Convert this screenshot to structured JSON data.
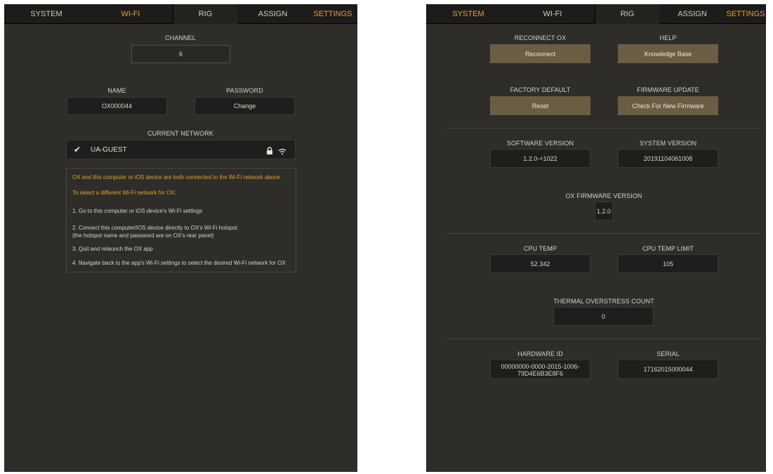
{
  "colors": {
    "accent": "#e3a32b",
    "panel_bg": "#2e2d2a",
    "tabbar_bg": "#1d1c1a",
    "field_bg": "#1f1e1c",
    "button_bg": "#6b5d43"
  },
  "wifi_screen": {
    "tabs": {
      "system": "SYSTEM",
      "wifi": "WI-FI",
      "rig": "RIG",
      "assign": "ASSIGN",
      "settings": "SETTINGS"
    },
    "active_tab": "WI-FI",
    "channel": {
      "label": "CHANNEL",
      "value": "6"
    },
    "name": {
      "label": "NAME",
      "value": "OX000044"
    },
    "password": {
      "label": "PASSWORD",
      "button": "Change"
    },
    "current_network": {
      "label": "CURRENT NETWORK",
      "ssid": "UA-GUEST",
      "icons": [
        "checkmark-icon",
        "lock-icon",
        "wifi-signal-icon"
      ]
    },
    "info": {
      "line1": "OX and this computer or iOS device are both connected to the Wi-Fi network above.",
      "line2": "To select a different Wi-Fi network for OX:",
      "step1": "1. Go to this computer or iOS device's Wi-Fi settings",
      "step2a": "2. Connect this computer/iOS device directly to OX's Wi-Fi hotspot",
      "step2b": "(the hotspot name and password are on OX's rear panel)",
      "step3": "3. Quit and relaunch the OX app",
      "step4": "4. Navigate back to the app's Wi-Fi settings to select the desired Wi-Fi network for OX"
    }
  },
  "system_screen": {
    "tabs": {
      "system": "SYSTEM",
      "wifi": "WI-FI",
      "rig": "RIG",
      "assign": "ASSIGN",
      "settings": "SETTINGS"
    },
    "active_tab": "SYSTEM",
    "reconnect": {
      "label": "RECONNECT OX",
      "button": "Reconnect"
    },
    "help": {
      "label": "HELP",
      "button": "Knowledge Base"
    },
    "factory_default": {
      "label": "FACTORY DEFAULT",
      "button": "Reset"
    },
    "firmware_update": {
      "label": "FIRMWARE UPDATE",
      "button": "Check For New Firmware"
    },
    "software_version": {
      "label": "SOFTWARE VERSION",
      "value": "1.2.0-+1022"
    },
    "system_version": {
      "label": "SYSTEM VERSION",
      "value": "20191104061008"
    },
    "ox_firmware_version": {
      "label": "OX FIRMWARE VERSION",
      "value": "1.2.0"
    },
    "cpu_temp": {
      "label": "CPU TEMP",
      "value": "52.342"
    },
    "cpu_temp_limit": {
      "label": "CPU TEMP LIMIT",
      "value": "105"
    },
    "thermal_overstress": {
      "label": "THERMAL OVERSTRESS COUNT",
      "value": "0"
    },
    "hardware_id": {
      "label": "HARDWARE ID",
      "value_line1": "00000000-0000-2015-1006-",
      "value_line2": "79D4E6B3E8F6"
    },
    "serial": {
      "label": "SERIAL",
      "value": "17162015000044"
    }
  }
}
